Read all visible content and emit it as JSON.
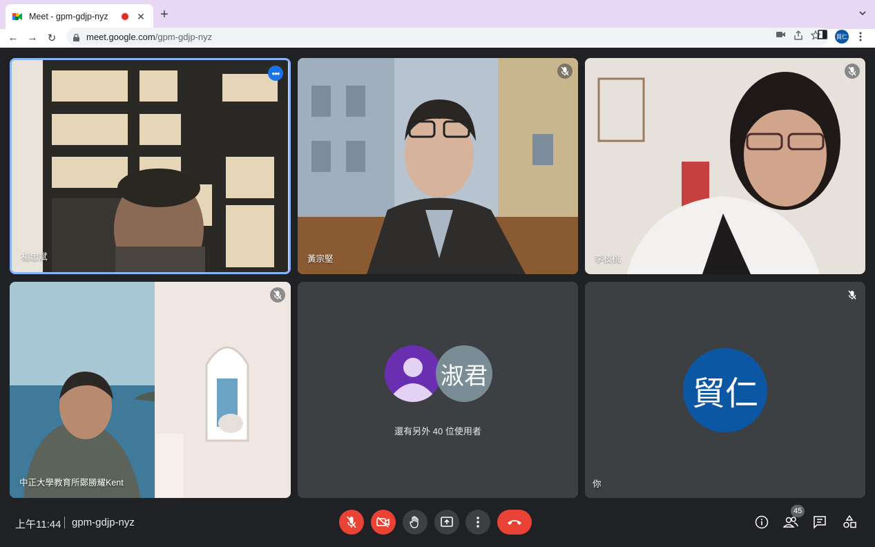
{
  "browser": {
    "tab": {
      "title": "Meet - gpm-gdjp-nyz",
      "close_label": "✕"
    },
    "new_tab_label": "+",
    "tabs_dropdown_label": "⌄",
    "url": {
      "host": "meet.google.com",
      "path": "/gpm-gdjp-nyz"
    },
    "profile_label": "貿仁",
    "nav": {
      "back": "←",
      "forward": "→",
      "reload": "↻"
    }
  },
  "tiles": [
    {
      "name": "楊忠斌",
      "status": "speaking",
      "icon": "more-icon"
    },
    {
      "name": "黃宗堅",
      "status": "muted",
      "icon": "mic-off-icon"
    },
    {
      "name": "李枝桃",
      "status": "muted",
      "icon": "mic-off-icon"
    },
    {
      "name": "中正大學教育所鄭勝耀Kent",
      "status": "muted",
      "icon": "mic-off-icon"
    }
  ],
  "others_tile": {
    "avatar_text": "淑君",
    "caption": "還有另外 40 位使用者"
  },
  "self_tile": {
    "avatar_text": "貿仁",
    "name": "你",
    "avatar_color": "#0b57a4"
  },
  "bottom_bar": {
    "time": "上午11:44",
    "meeting_code": "gpm-gdjp-nyz",
    "participant_count": "45",
    "controls": [
      "mic-off-icon",
      "camera-off-icon",
      "raise-hand-icon",
      "present-icon",
      "more-options-icon",
      "end-call-icon"
    ],
    "right_controls": [
      "info-icon",
      "people-icon",
      "chat-icon",
      "activities-icon"
    ]
  },
  "colors": {
    "accent": "#1a73e8",
    "danger": "#ea4335",
    "bg": "#202124",
    "tile": "#3c4043"
  }
}
